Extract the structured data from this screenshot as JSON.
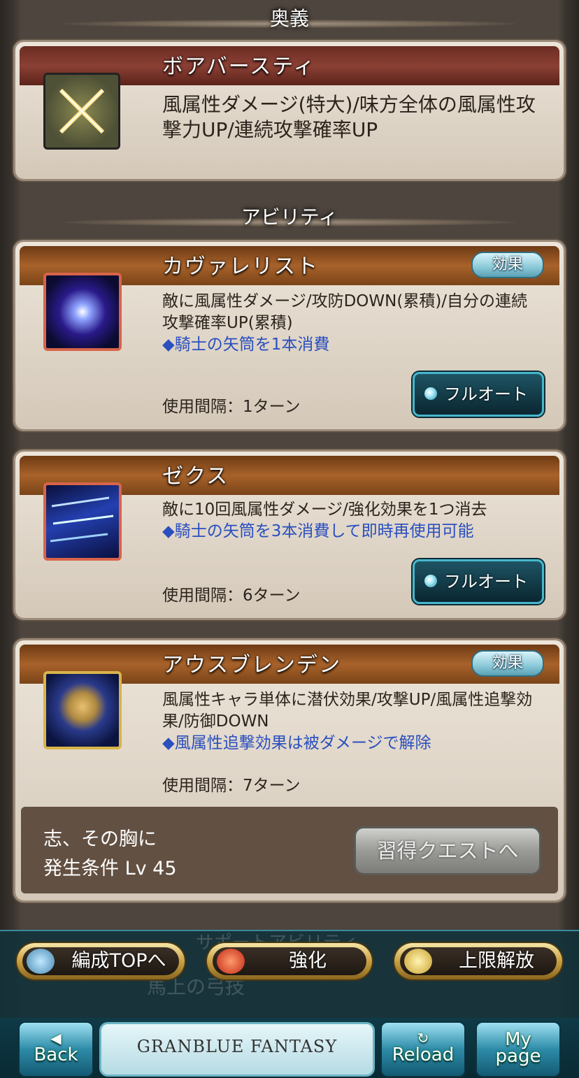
{
  "sections": {
    "ougi": "奥義",
    "ability": "アビリティ"
  },
  "ougi": {
    "name": "ボアバースティ",
    "desc": "風属性ダメージ(特大)/味方全体の風属性攻撃力UP/連続攻撃確率UP"
  },
  "abilities": [
    {
      "name": "カヴァレリスト",
      "badge": "効果",
      "desc": "敵に風属性ダメージ/攻防DOWN(累積)/自分の連続攻撃確率UP(累積)",
      "note": "◆騎士の矢筒を1本消費",
      "interval": "使用間隔：1ターン",
      "auto": "フルオート"
    },
    {
      "name": "ゼクス",
      "desc": "敵に10回風属性ダメージ/強化効果を1つ消去",
      "note": "◆騎士の矢筒を3本消費して即時再使用可能",
      "interval": "使用間隔：6ターン",
      "auto": "フルオート"
    },
    {
      "name": "アウスブレンデン",
      "badge": "効果",
      "desc": "風属性キャラ単体に潜伏効果/攻撃UP/風属性追撃効果/防御DOWN",
      "note": "◆風属性追撃効果は被ダメージで解除",
      "interval": "使用間隔：7ターン",
      "locked_title": "志、その胸に",
      "condition": "発生条件 Lv 45",
      "quest_button": "習得クエストへ"
    }
  ],
  "overlay": {
    "hidden_section": "サポートアビリティ",
    "hidden_item": "馬上の弓技",
    "buttons": {
      "party_top": "編成TOPへ",
      "enhance": "強化",
      "uncap": "上限解放"
    }
  },
  "nav": {
    "back": "Back",
    "logo": "GRANBLUE FANTASY",
    "reload": "Reload",
    "mypage_1": "My",
    "mypage_2": "page"
  }
}
